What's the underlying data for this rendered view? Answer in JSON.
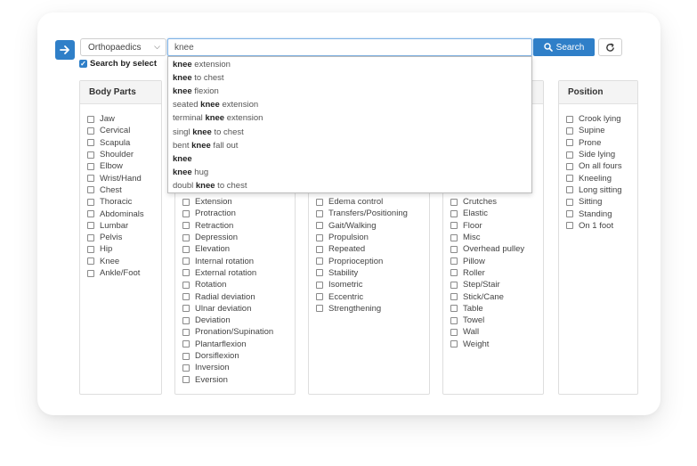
{
  "category_select": {
    "value": "Orthopaedics"
  },
  "search": {
    "value": "knee",
    "button_label": "Search"
  },
  "search_by_selection": {
    "label": "Search by select",
    "checked": true
  },
  "panels": {
    "body_parts": {
      "title": "Body Parts",
      "items": [
        "Jaw",
        "Cervical",
        "Scapula",
        "Shoulder",
        "Elbow",
        "Wrist/Hand",
        "Chest",
        "Thoracic",
        "Abdominals",
        "Lumbar",
        "Pelvis",
        "Hip",
        "Knee",
        "Ankle/Foot"
      ]
    },
    "motion": {
      "title": "",
      "items": [
        "Extension",
        "Protraction",
        "Retraction",
        "Depression",
        "Elevation",
        "Internal rotation",
        "External rotation",
        "Rotation",
        "Radial deviation",
        "Ulnar deviation",
        "Deviation",
        "Pronation/Supination",
        "Plantarflexion",
        "Dorsiflexion",
        "Inversion",
        "Eversion"
      ]
    },
    "type": {
      "title": "",
      "items": [
        "Edema control",
        "Transfers/Positioning",
        "Gait/Walking",
        "Propulsion",
        "Repeated",
        "Proprioception",
        "Stability",
        "Isometric",
        "Eccentric",
        "Strengthening"
      ]
    },
    "equipment": {
      "title": "",
      "items": [
        "Crutches",
        "Elastic",
        "Floor",
        "Misc",
        "Overhead pulley",
        "Pillow",
        "Roller",
        "Step/Stair",
        "Stick/Cane",
        "Table",
        "Towel",
        "Wall",
        "Weight"
      ]
    },
    "position": {
      "title": "Position",
      "items": [
        "Crook lying",
        "Supine",
        "Prone",
        "Side lying",
        "On all fours",
        "Kneeling",
        "Long sitting",
        "Sitting",
        "Standing",
        "On 1 foot"
      ]
    }
  },
  "suggestions": [
    {
      "pre": "",
      "match": "knee",
      "post": " extension"
    },
    {
      "pre": "",
      "match": "knee",
      "post": " to chest"
    },
    {
      "pre": "",
      "match": "knee",
      "post": " flexion"
    },
    {
      "pre": "seated ",
      "match": "knee",
      "post": " extension"
    },
    {
      "pre": "terminal ",
      "match": "knee",
      "post": " extension"
    },
    {
      "pre": "singl ",
      "match": "knee",
      "post": " to chest"
    },
    {
      "pre": "bent ",
      "match": "knee",
      "post": " fall out"
    },
    {
      "pre": "",
      "match": "knee",
      "post": ""
    },
    {
      "pre": "",
      "match": "knee",
      "post": " hug"
    },
    {
      "pre": "doubl ",
      "match": "knee",
      "post": " to chest"
    }
  ],
  "icons": {
    "nav": "arrow-right-icon",
    "search": "search-icon",
    "refresh": "refresh-icon",
    "select": "chevron-down-icon"
  },
  "colors": {
    "accent": "#2f7fc8",
    "panel_header": "#f4f4f4"
  }
}
